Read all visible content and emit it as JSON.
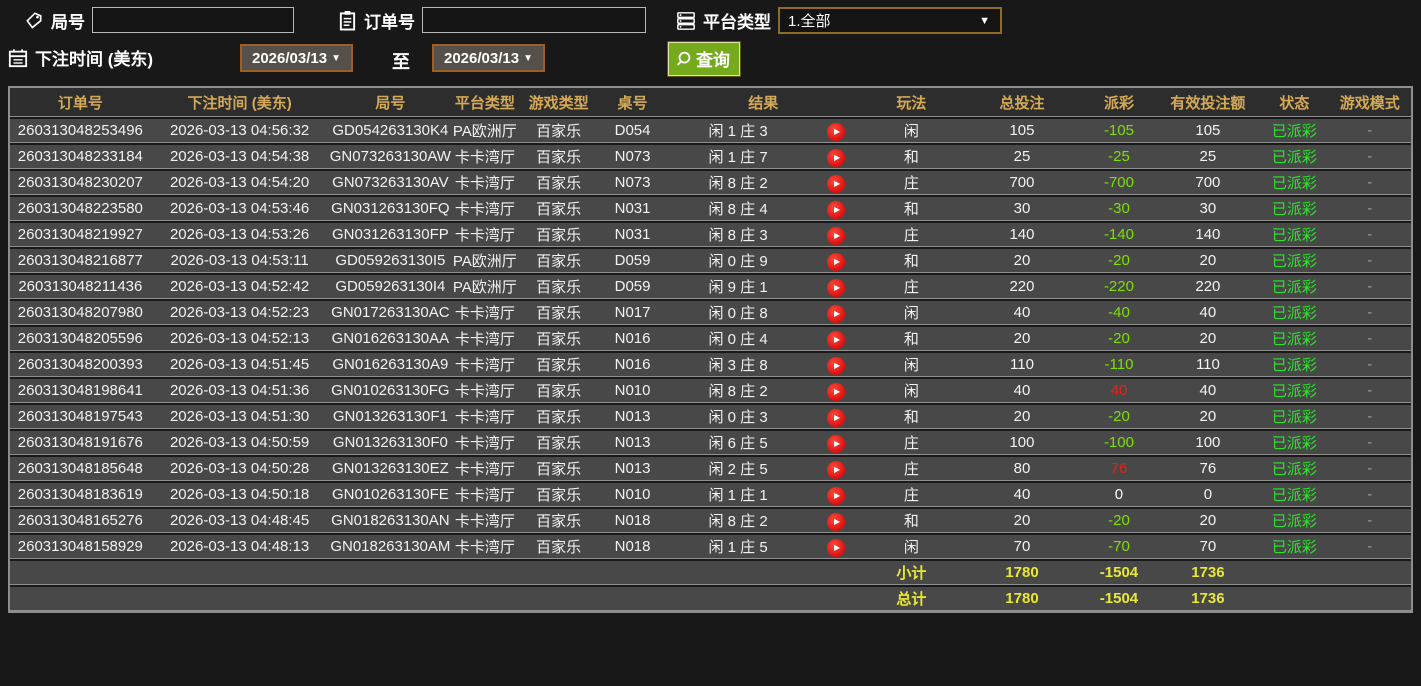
{
  "filters": {
    "round_label": "局号",
    "round_value": "",
    "order_label": "订单号",
    "order_value": "",
    "platform_label": "平台类型",
    "platform_value": "1.全部",
    "time_label": "下注时间 (美东)",
    "date_from": "2026/03/13",
    "to_label": "至",
    "date_to": "2026/03/13",
    "search_label": "查询"
  },
  "colors": {
    "header_gold": "#d4a957",
    "payout_green": "#7ce000",
    "payout_red": "#d42a1e",
    "status_green": "#2fe32f",
    "totals_yellow": "#e9e932",
    "button_green": "#74aa1c"
  },
  "icons": [
    "tag-icon",
    "clipboard-icon",
    "server-list-icon",
    "calendar-icon",
    "search-icon",
    "play-icon"
  ],
  "table": {
    "headers": [
      "订单号",
      "下注时间 (美东)",
      "局号",
      "平台类型",
      "游戏类型",
      "桌号",
      "结果",
      "玩法",
      "总投注",
      "派彩",
      "有效投注额",
      "状态",
      "游戏模式"
    ],
    "rows": [
      {
        "order": "260313048253496",
        "time": "2026-03-13 04:56:32",
        "round": "GD054263130K4",
        "platform": "PA欧洲厅",
        "game": "百家乐",
        "table_no": "D054",
        "result": "闲 1 庄 3",
        "play": "闲",
        "total": "105",
        "payout": "-105",
        "valid": "105",
        "status": "已派彩",
        "mode": "-"
      },
      {
        "order": "260313048233184",
        "time": "2026-03-13 04:54:38",
        "round": "GN073263130AW",
        "platform": "卡卡湾厅",
        "game": "百家乐",
        "table_no": "N073",
        "result": "闲 1 庄 7",
        "play": "和",
        "total": "25",
        "payout": "-25",
        "valid": "25",
        "status": "已派彩",
        "mode": "-"
      },
      {
        "order": "260313048230207",
        "time": "2026-03-13 04:54:20",
        "round": "GN073263130AV",
        "platform": "卡卡湾厅",
        "game": "百家乐",
        "table_no": "N073",
        "result": "闲 8 庄 2",
        "play": "庄",
        "total": "700",
        "payout": "-700",
        "valid": "700",
        "status": "已派彩",
        "mode": "-"
      },
      {
        "order": "260313048223580",
        "time": "2026-03-13 04:53:46",
        "round": "GN031263130FQ",
        "platform": "卡卡湾厅",
        "game": "百家乐",
        "table_no": "N031",
        "result": "闲 8 庄 4",
        "play": "和",
        "total": "30",
        "payout": "-30",
        "valid": "30",
        "status": "已派彩",
        "mode": "-"
      },
      {
        "order": "260313048219927",
        "time": "2026-03-13 04:53:26",
        "round": "GN031263130FP",
        "platform": "卡卡湾厅",
        "game": "百家乐",
        "table_no": "N031",
        "result": "闲 8 庄 3",
        "play": "庄",
        "total": "140",
        "payout": "-140",
        "valid": "140",
        "status": "已派彩",
        "mode": "-"
      },
      {
        "order": "260313048216877",
        "time": "2026-03-13 04:53:11",
        "round": "GD059263130I5",
        "platform": "PA欧洲厅",
        "game": "百家乐",
        "table_no": "D059",
        "result": "闲 0 庄 9",
        "play": "和",
        "total": "20",
        "payout": "-20",
        "valid": "20",
        "status": "已派彩",
        "mode": "-"
      },
      {
        "order": "260313048211436",
        "time": "2026-03-13 04:52:42",
        "round": "GD059263130I4",
        "platform": "PA欧洲厅",
        "game": "百家乐",
        "table_no": "D059",
        "result": "闲 9 庄 1",
        "play": "庄",
        "total": "220",
        "payout": "-220",
        "valid": "220",
        "status": "已派彩",
        "mode": "-"
      },
      {
        "order": "260313048207980",
        "time": "2026-03-13 04:52:23",
        "round": "GN017263130AC",
        "platform": "卡卡湾厅",
        "game": "百家乐",
        "table_no": "N017",
        "result": "闲 0 庄 8",
        "play": "闲",
        "total": "40",
        "payout": "-40",
        "valid": "40",
        "status": "已派彩",
        "mode": "-"
      },
      {
        "order": "260313048205596",
        "time": "2026-03-13 04:52:13",
        "round": "GN016263130AA",
        "platform": "卡卡湾厅",
        "game": "百家乐",
        "table_no": "N016",
        "result": "闲 0 庄 4",
        "play": "和",
        "total": "20",
        "payout": "-20",
        "valid": "20",
        "status": "已派彩",
        "mode": "-"
      },
      {
        "order": "260313048200393",
        "time": "2026-03-13 04:51:45",
        "round": "GN016263130A9",
        "platform": "卡卡湾厅",
        "game": "百家乐",
        "table_no": "N016",
        "result": "闲 3 庄 8",
        "play": "闲",
        "total": "110",
        "payout": "-110",
        "valid": "110",
        "status": "已派彩",
        "mode": "-"
      },
      {
        "order": "260313048198641",
        "time": "2026-03-13 04:51:36",
        "round": "GN010263130FG",
        "platform": "卡卡湾厅",
        "game": "百家乐",
        "table_no": "N010",
        "result": "闲 8 庄 2",
        "play": "闲",
        "total": "40",
        "payout": "40",
        "valid": "40",
        "status": "已派彩",
        "mode": "-"
      },
      {
        "order": "260313048197543",
        "time": "2026-03-13 04:51:30",
        "round": "GN013263130F1",
        "platform": "卡卡湾厅",
        "game": "百家乐",
        "table_no": "N013",
        "result": "闲 0 庄 3",
        "play": "和",
        "total": "20",
        "payout": "-20",
        "valid": "20",
        "status": "已派彩",
        "mode": "-"
      },
      {
        "order": "260313048191676",
        "time": "2026-03-13 04:50:59",
        "round": "GN013263130F0",
        "platform": "卡卡湾厅",
        "game": "百家乐",
        "table_no": "N013",
        "result": "闲 6 庄 5",
        "play": "庄",
        "total": "100",
        "payout": "-100",
        "valid": "100",
        "status": "已派彩",
        "mode": "-"
      },
      {
        "order": "260313048185648",
        "time": "2026-03-13 04:50:28",
        "round": "GN013263130EZ",
        "platform": "卡卡湾厅",
        "game": "百家乐",
        "table_no": "N013",
        "result": "闲 2 庄 5",
        "play": "庄",
        "total": "80",
        "payout": "76",
        "valid": "76",
        "status": "已派彩",
        "mode": "-"
      },
      {
        "order": "260313048183619",
        "time": "2026-03-13 04:50:18",
        "round": "GN010263130FE",
        "platform": "卡卡湾厅",
        "game": "百家乐",
        "table_no": "N010",
        "result": "闲 1 庄 1",
        "play": "庄",
        "total": "40",
        "payout": "0",
        "valid": "0",
        "status": "已派彩",
        "mode": "-"
      },
      {
        "order": "260313048165276",
        "time": "2026-03-13 04:48:45",
        "round": "GN018263130AN",
        "platform": "卡卡湾厅",
        "game": "百家乐",
        "table_no": "N018",
        "result": "闲 8 庄 2",
        "play": "和",
        "total": "20",
        "payout": "-20",
        "valid": "20",
        "status": "已派彩",
        "mode": "-"
      },
      {
        "order": "260313048158929",
        "time": "2026-03-13 04:48:13",
        "round": "GN018263130AM",
        "platform": "卡卡湾厅",
        "game": "百家乐",
        "table_no": "N018",
        "result": "闲 1 庄 5",
        "play": "闲",
        "total": "70",
        "payout": "-70",
        "valid": "70",
        "status": "已派彩",
        "mode": "-"
      }
    ],
    "subtotal": {
      "label": "小计",
      "total": "1780",
      "payout": "-1504",
      "valid": "1736"
    },
    "grand_total": {
      "label": "总计",
      "total": "1780",
      "payout": "-1504",
      "valid": "1736"
    }
  }
}
